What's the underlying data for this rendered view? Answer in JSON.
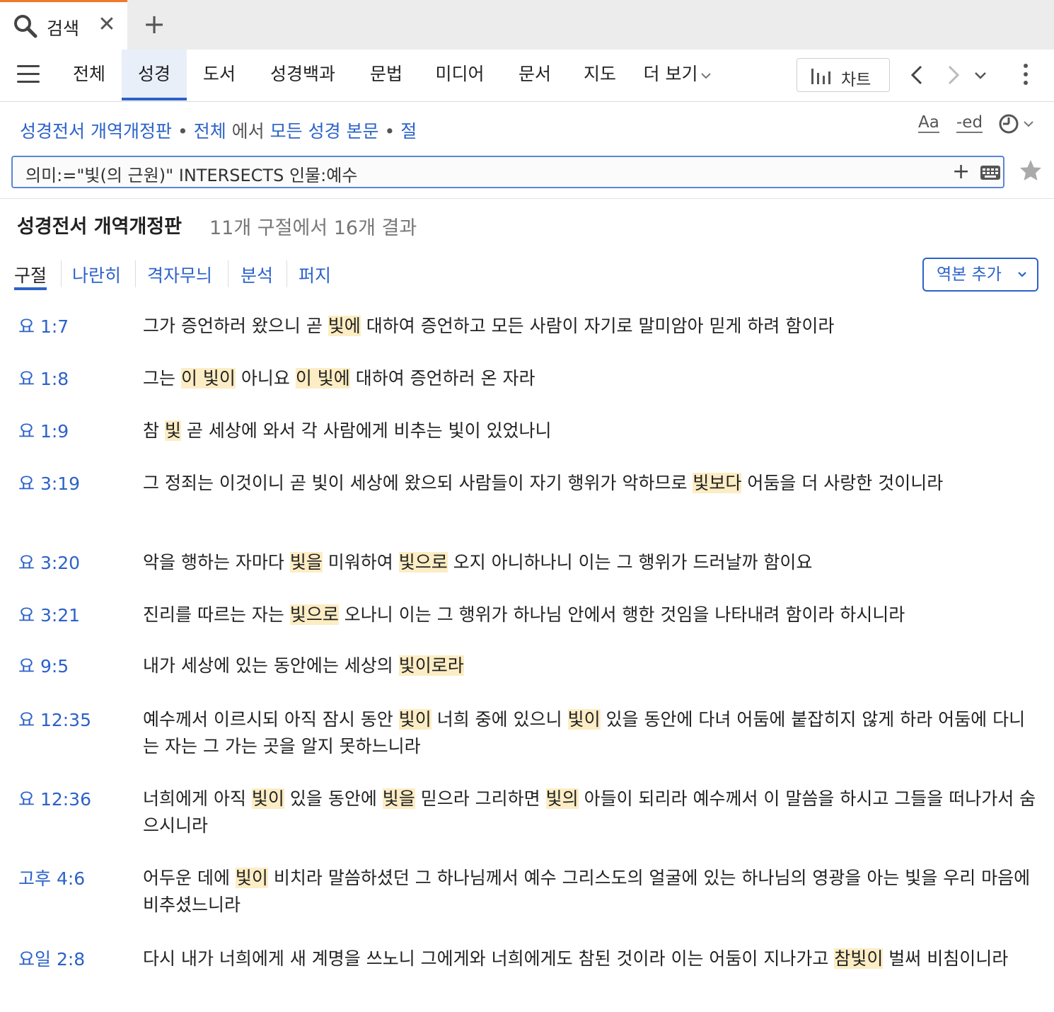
{
  "tabbar": {
    "tab_label": "검색",
    "close_glyph": "✕",
    "add_glyph": "+"
  },
  "nav": {
    "items": [
      "전체",
      "성경",
      "도서",
      "성경백과",
      "문법",
      "미디어",
      "문서",
      "지도",
      "더 보기"
    ],
    "active_index": 1,
    "chart_label": "차트",
    "back_glyph": "‹",
    "forward_glyph": "›"
  },
  "breadcrumb": {
    "bible": "성경전서 개역개정판",
    "dot": "•",
    "range": "전체",
    "in_text": "에서",
    "scope": "모든 성경 본문",
    "unit": "절"
  },
  "toolbar": {
    "aa_label": "Aa",
    "ed_label": "-ed"
  },
  "search": {
    "query": "의미:=\"빛(의 근원)\" INTERSECTS 인물:예수",
    "add_glyph": "+"
  },
  "results": {
    "title": "성경전서 개역개정판",
    "count": "11개 구절에서 16개 결과"
  },
  "view_tabs": [
    "구절",
    "나란히",
    "격자무늬",
    "분석",
    "퍼지"
  ],
  "add_version_label": "역본 추가",
  "colors": {
    "accent": "#2c62c9",
    "highlight": "#fdedc4",
    "tab_accent": "#f07a2a"
  },
  "verses": [
    {
      "ref": "요 1:7",
      "parts": [
        {
          "t": "그가 증언하러 왔으니 곧 "
        },
        {
          "t": "빛에",
          "hl": true
        },
        {
          "t": " 대하여 증언하고 모든 사람이 자기로 말미암아 믿게 하려 함이라"
        }
      ]
    },
    {
      "ref": "요 1:8",
      "parts": [
        {
          "t": "그는 "
        },
        {
          "t": "이 빛이",
          "hl": true
        },
        {
          "t": " 아니요 "
        },
        {
          "t": "이 빛에",
          "hl": true
        },
        {
          "t": " 대하여 증언하러 온 자라"
        }
      ]
    },
    {
      "ref": "요 1:9",
      "parts": [
        {
          "t": "참 "
        },
        {
          "t": "빛",
          "hl": true
        },
        {
          "t": " 곧 세상에 와서 각 사람에게 비추는 빛이 있었나니"
        }
      ]
    },
    {
      "ref": "요 3:19",
      "parts": [
        {
          "t": "그 정죄는 이것이니 곧 빛이 세상에 왔으되 사람들이 자기 행위가 악하므로 "
        },
        {
          "t": "빛보다",
          "hl": true
        },
        {
          "t": " 어둠을 더 사랑한 것이니라"
        }
      ]
    },
    {
      "ref": "요 3:20",
      "parts": [
        {
          "t": "악을 행하는 자마다 "
        },
        {
          "t": "빛을",
          "hl": true
        },
        {
          "t": " 미워하여 "
        },
        {
          "t": "빛으로",
          "hl": true
        },
        {
          "t": " 오지 아니하나니 이는 그 행위가 드러날까 함이요"
        }
      ]
    },
    {
      "ref": "요 3:21",
      "parts": [
        {
          "t": "진리를 따르는 자는 "
        },
        {
          "t": "빛으로",
          "hl": true
        },
        {
          "t": " 오나니 이는 그 행위가 하나님 안에서 행한 것임을 나타내려 함이라 하시니라"
        }
      ]
    },
    {
      "ref": "요 9:5",
      "parts": [
        {
          "t": "내가 세상에 있는 동안에는 세상의 "
        },
        {
          "t": "빛이로라",
          "hl": true
        }
      ]
    },
    {
      "ref": "요 12:35",
      "parts": [
        {
          "t": "예수께서 이르시되 아직 잠시 동안 "
        },
        {
          "t": "빛이",
          "hl": true
        },
        {
          "t": " 너희 중에 있으니 "
        },
        {
          "t": "빛이",
          "hl": true
        },
        {
          "t": " 있을 동안에 다녀 어둠에 붙잡히지 않게 하라 어둠에 다니는 자는 그 가는 곳을 알지 못하느니라"
        }
      ]
    },
    {
      "ref": "요 12:36",
      "parts": [
        {
          "t": "너희에게 아직 "
        },
        {
          "t": "빛이",
          "hl": true
        },
        {
          "t": " 있을 동안에 "
        },
        {
          "t": "빛을",
          "hl": true
        },
        {
          "t": " 믿으라 그리하면 "
        },
        {
          "t": "빛의",
          "hl": true
        },
        {
          "t": " 아들이 되리라 예수께서 이 말씀을 하시고 그들을 떠나가서 숨으시니라"
        }
      ]
    },
    {
      "ref": "고후 4:6",
      "parts": [
        {
          "t": "어두운 데에 "
        },
        {
          "t": "빛이",
          "hl": true
        },
        {
          "t": " 비치라 말씀하셨던 그 하나님께서 예수 그리스도의 얼굴에 있는 하나님의 영광을 아는 빛을 우리 마음에 비추셨느니라"
        }
      ]
    },
    {
      "ref": "요일 2:8",
      "parts": [
        {
          "t": "다시 내가 너희에게 새 계명을 쓰노니 그에게와 너희에게도 참된 것이라 이는 어둠이 지나가고 "
        },
        {
          "t": "참빛이",
          "hl": true
        },
        {
          "t": " 벌써 비침이니라"
        }
      ]
    }
  ]
}
